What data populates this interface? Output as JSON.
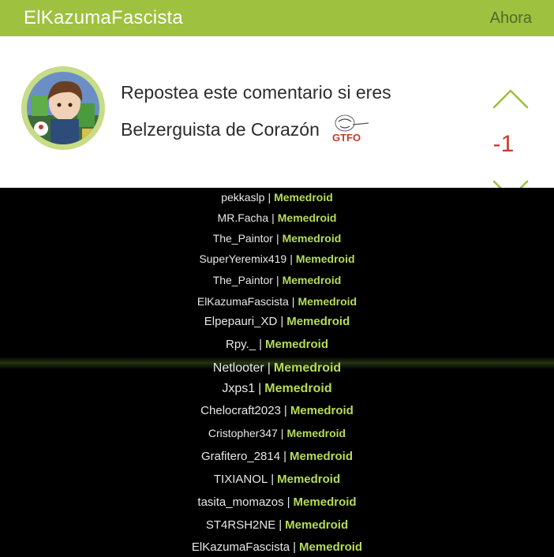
{
  "header": {
    "username": "ElKazumaFascista",
    "time": "Ahora"
  },
  "comment": {
    "line1": "Repostea este comentario si eres",
    "line2": "Belzerguista de Corazón",
    "meme_label": "GTFO",
    "score": "-1"
  },
  "icons": {
    "upvote": "chevron-up-icon",
    "downvote": "chevron-down-icon"
  },
  "colors": {
    "header_bg": "#9ec13f",
    "score": "#c43b2d",
    "arrow": "#9ec13f",
    "site": "#b5dc58"
  },
  "list": {
    "separator": "|",
    "site": "Memedroid",
    "names": [
      "pekkaslp",
      "MR.Facha",
      "The_Paintor",
      "SuperYeremix419",
      "The_Paintor",
      "ElKazumaFascista",
      "Elpepauri_XD",
      "Rpy._",
      "Netlooter",
      "Jxps1",
      "Chelocraft2023",
      "Cristopher347",
      "Grafitero_2814",
      "TIXIANOL",
      "tasita_momazos",
      "ST4RSH2NE",
      "ElKazumaFascista"
    ]
  }
}
